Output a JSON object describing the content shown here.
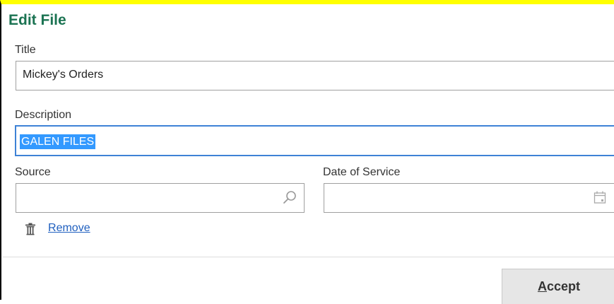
{
  "dialog": {
    "title": "Edit File"
  },
  "title_field": {
    "label": "Title",
    "value": "Mickey's Orders"
  },
  "description_field": {
    "label": "Description",
    "value": "GALEN FILES"
  },
  "source_field": {
    "label": "Source",
    "value": "",
    "icon": "search-icon"
  },
  "date_field": {
    "label": "Date of Service",
    "value": "",
    "icon": "calendar-icon"
  },
  "remove": {
    "mnemonic": "R",
    "rest": "emove",
    "icon": "trash-icon"
  },
  "accept": {
    "mnemonic": "A",
    "rest": "ccept"
  },
  "colors": {
    "title": "#1b7352",
    "focus_border": "#3e82d6",
    "selection": "#3399ff",
    "link": "#1f5fbf"
  }
}
